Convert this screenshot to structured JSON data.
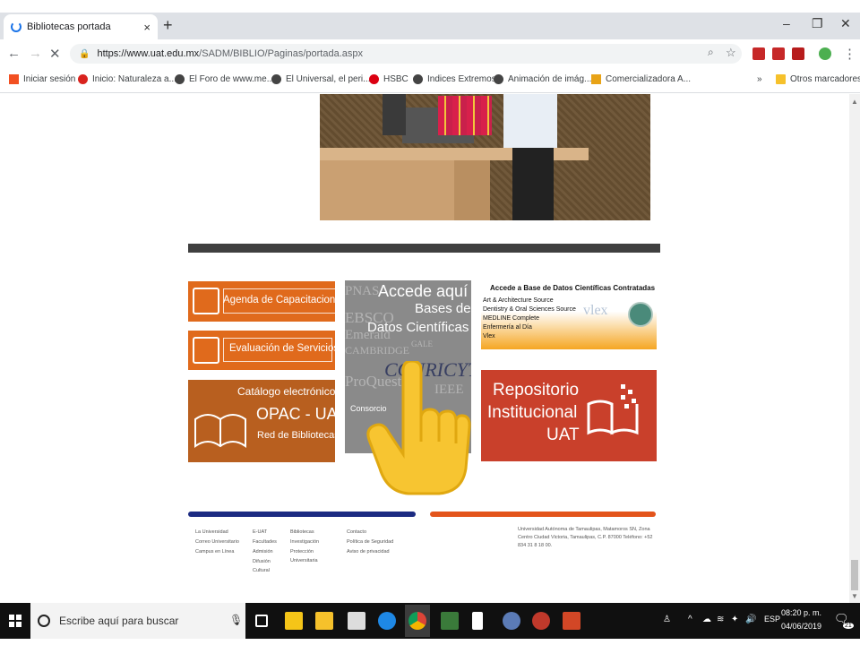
{
  "browser": {
    "tab_title": "Bibliotecas portada",
    "tab_close": "×",
    "new_tab": "+",
    "url_host": "https://www.uat.edu.mx",
    "url_path": "/SADM/BIBLIO/Paginas/portada.aspx",
    "bookmarks": [
      {
        "label": "Iniciar sesión",
        "color": "#f25022"
      },
      {
        "label": "Inicio: Naturaleza a...",
        "color": "#d9231e"
      },
      {
        "label": "El Foro de www.me...",
        "color": "#444444"
      },
      {
        "label": "El Universal, el peri...",
        "color": "#444444"
      },
      {
        "label": "HSBC",
        "color": "#db0011"
      },
      {
        "label": "Indices Extremos",
        "color": "#444444"
      },
      {
        "label": "Animación de imág...",
        "color": "#444444"
      },
      {
        "label": "Comercializadora A...",
        "color": "#e8a317"
      }
    ],
    "bookmarks_more": "»",
    "other_bookmarks": "Otros marcadores"
  },
  "tiles": {
    "agenda": "Agenda de Capacitaciones",
    "evaluacion": "Evaluación de Servicios",
    "catalogo_line1": "Catálogo electrónico",
    "catalogo_line2": "OPAC - UAT",
    "catalogo_line3": "Red de Bibliotecas",
    "bases_title": "Accede aquí",
    "bases_sub1": "Bases de",
    "bases_sub2": "Datos Científicas",
    "bases_bg": [
      "PNAS",
      "EBSCO",
      "Emerald",
      "CAMBRIDGE",
      "ProQuest",
      "CONRICYT",
      "IEEE",
      "GALE",
      "Consorcio"
    ],
    "contratadas_title": "Accede a Base de Datos Científicas Contratadas",
    "contratadas_items": [
      "Art & Architecture Source",
      "Dentistry & Oral Sciences Source",
      "MEDLINE Complete",
      "Enfermería al Día",
      "Vlex"
    ],
    "repositorio_line1": "Repositorio",
    "repositorio_line2": "Institucional",
    "repositorio_line3": "UAT"
  },
  "footer": {
    "col1": [
      "La Universidad",
      "Correo Universitario",
      "Campus en Línea"
    ],
    "col2": [
      "E-UAT",
      "Facultades",
      "Admisión",
      "Difusión Cultural"
    ],
    "col3": [
      "Bibliotecas",
      "Investigación",
      "Protección Universitaria"
    ],
    "col4": [
      "Contacto",
      "Política de Seguridad",
      "Aviso de privacidad"
    ],
    "address": "Universidad Autónoma de Tamaulipas, Matamoros SN, Zona Centro Ciudad Victoria, Tamaulipas, C.P. 87000 Teléfono: +52 834 31 8 18 00."
  },
  "taskbar": {
    "search_placeholder": "Escribe aquí para buscar",
    "lang": "ESP",
    "time": "08:20 p. m.",
    "date": "04/06/2019",
    "notif_count": "21"
  }
}
